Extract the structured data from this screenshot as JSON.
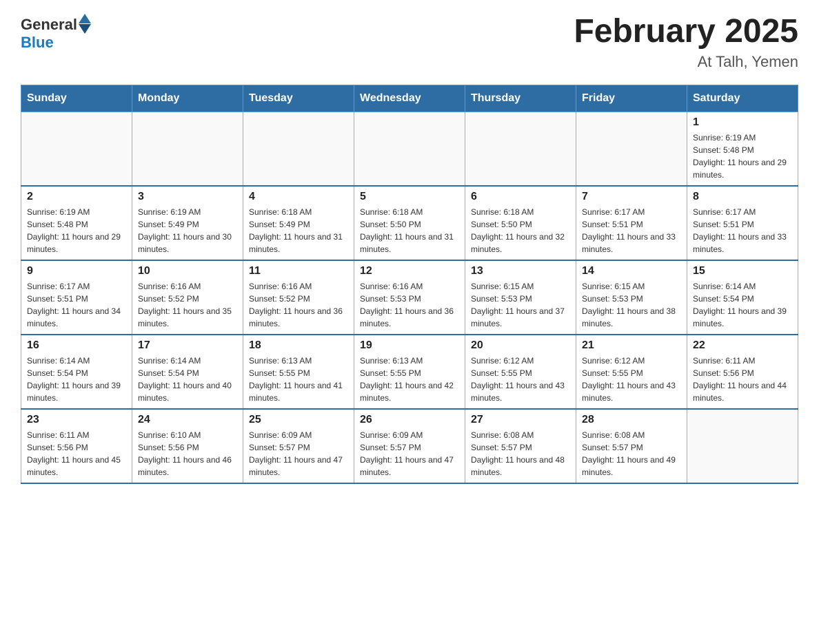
{
  "logo": {
    "general": "General",
    "arrow": "▲",
    "blue": "Blue"
  },
  "title": "February 2025",
  "subtitle": "At Talh, Yemen",
  "days_of_week": [
    "Sunday",
    "Monday",
    "Tuesday",
    "Wednesday",
    "Thursday",
    "Friday",
    "Saturday"
  ],
  "weeks": [
    [
      {
        "day": "",
        "info": ""
      },
      {
        "day": "",
        "info": ""
      },
      {
        "day": "",
        "info": ""
      },
      {
        "day": "",
        "info": ""
      },
      {
        "day": "",
        "info": ""
      },
      {
        "day": "",
        "info": ""
      },
      {
        "day": "1",
        "info": "Sunrise: 6:19 AM\nSunset: 5:48 PM\nDaylight: 11 hours and 29 minutes."
      }
    ],
    [
      {
        "day": "2",
        "info": "Sunrise: 6:19 AM\nSunset: 5:48 PM\nDaylight: 11 hours and 29 minutes."
      },
      {
        "day": "3",
        "info": "Sunrise: 6:19 AM\nSunset: 5:49 PM\nDaylight: 11 hours and 30 minutes."
      },
      {
        "day": "4",
        "info": "Sunrise: 6:18 AM\nSunset: 5:49 PM\nDaylight: 11 hours and 31 minutes."
      },
      {
        "day": "5",
        "info": "Sunrise: 6:18 AM\nSunset: 5:50 PM\nDaylight: 11 hours and 31 minutes."
      },
      {
        "day": "6",
        "info": "Sunrise: 6:18 AM\nSunset: 5:50 PM\nDaylight: 11 hours and 32 minutes."
      },
      {
        "day": "7",
        "info": "Sunrise: 6:17 AM\nSunset: 5:51 PM\nDaylight: 11 hours and 33 minutes."
      },
      {
        "day": "8",
        "info": "Sunrise: 6:17 AM\nSunset: 5:51 PM\nDaylight: 11 hours and 33 minutes."
      }
    ],
    [
      {
        "day": "9",
        "info": "Sunrise: 6:17 AM\nSunset: 5:51 PM\nDaylight: 11 hours and 34 minutes."
      },
      {
        "day": "10",
        "info": "Sunrise: 6:16 AM\nSunset: 5:52 PM\nDaylight: 11 hours and 35 minutes."
      },
      {
        "day": "11",
        "info": "Sunrise: 6:16 AM\nSunset: 5:52 PM\nDaylight: 11 hours and 36 minutes."
      },
      {
        "day": "12",
        "info": "Sunrise: 6:16 AM\nSunset: 5:53 PM\nDaylight: 11 hours and 36 minutes."
      },
      {
        "day": "13",
        "info": "Sunrise: 6:15 AM\nSunset: 5:53 PM\nDaylight: 11 hours and 37 minutes."
      },
      {
        "day": "14",
        "info": "Sunrise: 6:15 AM\nSunset: 5:53 PM\nDaylight: 11 hours and 38 minutes."
      },
      {
        "day": "15",
        "info": "Sunrise: 6:14 AM\nSunset: 5:54 PM\nDaylight: 11 hours and 39 minutes."
      }
    ],
    [
      {
        "day": "16",
        "info": "Sunrise: 6:14 AM\nSunset: 5:54 PM\nDaylight: 11 hours and 39 minutes."
      },
      {
        "day": "17",
        "info": "Sunrise: 6:14 AM\nSunset: 5:54 PM\nDaylight: 11 hours and 40 minutes."
      },
      {
        "day": "18",
        "info": "Sunrise: 6:13 AM\nSunset: 5:55 PM\nDaylight: 11 hours and 41 minutes."
      },
      {
        "day": "19",
        "info": "Sunrise: 6:13 AM\nSunset: 5:55 PM\nDaylight: 11 hours and 42 minutes."
      },
      {
        "day": "20",
        "info": "Sunrise: 6:12 AM\nSunset: 5:55 PM\nDaylight: 11 hours and 43 minutes."
      },
      {
        "day": "21",
        "info": "Sunrise: 6:12 AM\nSunset: 5:55 PM\nDaylight: 11 hours and 43 minutes."
      },
      {
        "day": "22",
        "info": "Sunrise: 6:11 AM\nSunset: 5:56 PM\nDaylight: 11 hours and 44 minutes."
      }
    ],
    [
      {
        "day": "23",
        "info": "Sunrise: 6:11 AM\nSunset: 5:56 PM\nDaylight: 11 hours and 45 minutes."
      },
      {
        "day": "24",
        "info": "Sunrise: 6:10 AM\nSunset: 5:56 PM\nDaylight: 11 hours and 46 minutes."
      },
      {
        "day": "25",
        "info": "Sunrise: 6:09 AM\nSunset: 5:57 PM\nDaylight: 11 hours and 47 minutes."
      },
      {
        "day": "26",
        "info": "Sunrise: 6:09 AM\nSunset: 5:57 PM\nDaylight: 11 hours and 47 minutes."
      },
      {
        "day": "27",
        "info": "Sunrise: 6:08 AM\nSunset: 5:57 PM\nDaylight: 11 hours and 48 minutes."
      },
      {
        "day": "28",
        "info": "Sunrise: 6:08 AM\nSunset: 5:57 PM\nDaylight: 11 hours and 49 minutes."
      },
      {
        "day": "",
        "info": ""
      }
    ]
  ]
}
